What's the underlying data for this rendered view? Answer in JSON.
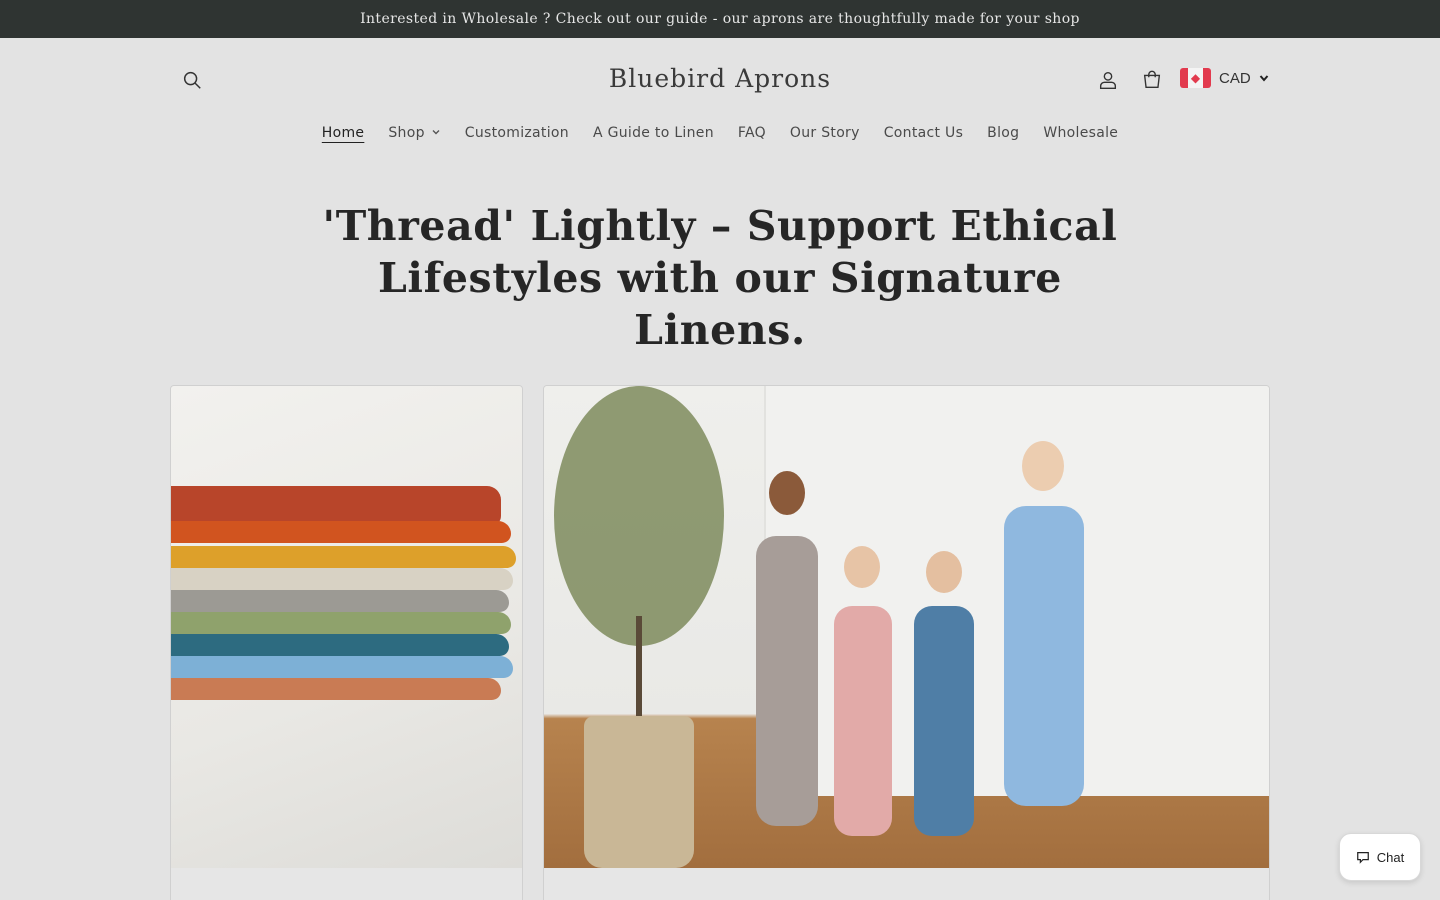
{
  "announcement": "Interested in Wholesale ? Check out our guide - our aprons are thoughtfully made for your shop",
  "header": {
    "logo": "Bluebird Aprons",
    "currency": "CAD",
    "icons": [
      "search-icon",
      "account-icon",
      "cart-icon",
      "chevron-down-icon"
    ]
  },
  "nav": {
    "items": [
      {
        "label": "Home",
        "active": true
      },
      {
        "label": "Shop",
        "has_dropdown": true
      },
      {
        "label": "Customization"
      },
      {
        "label": "A Guide to Linen"
      },
      {
        "label": "FAQ"
      },
      {
        "label": "Our Story"
      },
      {
        "label": "Contact Us"
      },
      {
        "label": "Blog"
      },
      {
        "label": "Wholesale"
      }
    ]
  },
  "hero": {
    "line1": "'Thread' Lightly – Support Ethical",
    "line2": "Lifestyles with our Signature Linens."
  },
  "chat": {
    "label": "Chat"
  },
  "colors": {
    "announcement_bg": "#2f3432",
    "page_bg": "#e3e3e3",
    "flag_red": "#e23a4e"
  }
}
